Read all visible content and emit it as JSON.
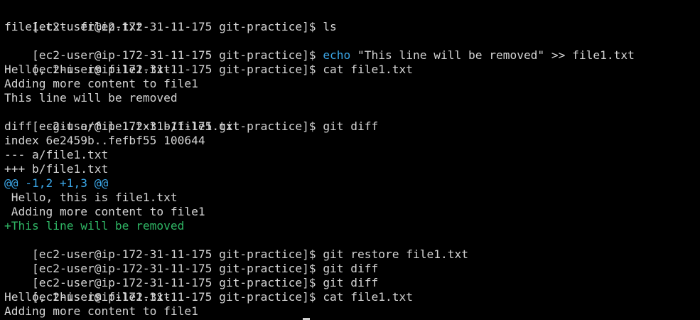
{
  "terminal": {
    "colors": {
      "background": "#000000",
      "text": "#d4d4d4",
      "accent_blue": "#3ba7e8",
      "diff_add_green": "#2fb564"
    },
    "prompt": "[ec2-user@ip-172-31-11-175 git-practice]$",
    "lines": [
      {
        "prompt": "[ec2-user@ip-172-31-11-175 git-practice]$",
        "cmd": "ls"
      },
      {
        "text": "file1.txt  file2.txt"
      },
      {
        "prompt": "[ec2-user@ip-172-31-11-175 git-practice]$",
        "cmd_keyword": "echo",
        "cmd_rest": " \"This line will be removed\" >> file1.txt"
      },
      {
        "prompt": "[ec2-user@ip-172-31-11-175 git-practice]$",
        "cmd": "cat file1.txt"
      },
      {
        "text": "Hello, this is file1.txt"
      },
      {
        "text": "Adding more content to file1"
      },
      {
        "text": "This line will be removed"
      },
      {
        "prompt": "[ec2-user@ip-172-31-11-175 git-practice]$",
        "cmd": "git diff"
      },
      {
        "text": "diff --git a/file1.txt b/file1.txt"
      },
      {
        "text": "index 6e2459b..fefbf55 100644"
      },
      {
        "text": "--- a/file1.txt"
      },
      {
        "text": "+++ b/file1.txt"
      },
      {
        "text": "@@ -1,2 +1,3 @@"
      },
      {
        "text": " Hello, this is file1.txt"
      },
      {
        "text": " Adding more content to file1"
      },
      {
        "text": "+This line will be removed"
      },
      {
        "prompt": "[ec2-user@ip-172-31-11-175 git-practice]$",
        "cmd": "git restore file1.txt"
      },
      {
        "prompt": "[ec2-user@ip-172-31-11-175 git-practice]$",
        "cmd": "git diff"
      },
      {
        "prompt": "[ec2-user@ip-172-31-11-175 git-practice]$",
        "cmd": "git diff"
      },
      {
        "prompt": "[ec2-user@ip-172-31-11-175 git-practice]$",
        "cmd": "cat file1.txt"
      },
      {
        "text": "Hello, this is file1.txt"
      },
      {
        "text": "Adding more content to file1"
      }
    ]
  }
}
